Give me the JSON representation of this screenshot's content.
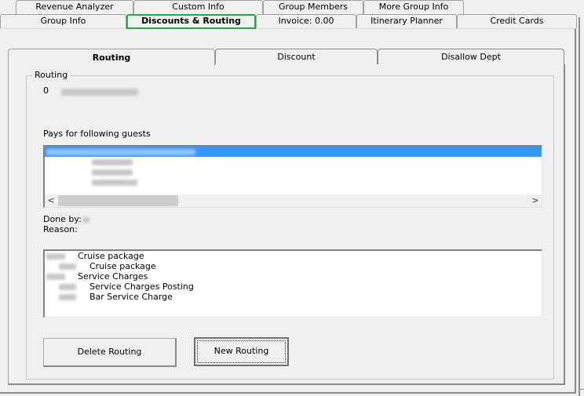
{
  "top_tabs": {
    "row1": [
      {
        "label": "Revenue Analyzer"
      },
      {
        "label": "Custom Info"
      },
      {
        "label": "Group Members"
      },
      {
        "label": "More Group Info"
      }
    ],
    "row2": [
      {
        "label": "Group Info"
      },
      {
        "label": "Discounts & Routing",
        "active": true
      },
      {
        "label": "Invoice: 0.00"
      },
      {
        "label": "Itinerary Planner"
      },
      {
        "label": "Credit Cards"
      }
    ],
    "active_highlight_color": "#22aa44"
  },
  "inner_tabs": [
    {
      "label": "Routing",
      "active": true
    },
    {
      "label": "Discount"
    },
    {
      "label": "Disallow Dept"
    }
  ],
  "routing_group": {
    "legend": "Routing",
    "routing_number": "0",
    "pays_for_label": "Pays for following guests",
    "guests_selection_color": "#3399ff",
    "done_by_label": "Done by:",
    "reason_label": "Reason:",
    "charges": [
      {
        "label": "Cruise package",
        "level": 0
      },
      {
        "label": "Cruise package",
        "level": 1
      },
      {
        "label": "Service Charges",
        "level": 0
      },
      {
        "label": "Service Charges Posting",
        "level": 1
      },
      {
        "label": "Bar Service Charge",
        "level": 1
      }
    ],
    "scroll_left": "<",
    "scroll_right": ">"
  },
  "buttons": {
    "delete_routing": "Delete Routing",
    "new_routing": "New Routing"
  }
}
